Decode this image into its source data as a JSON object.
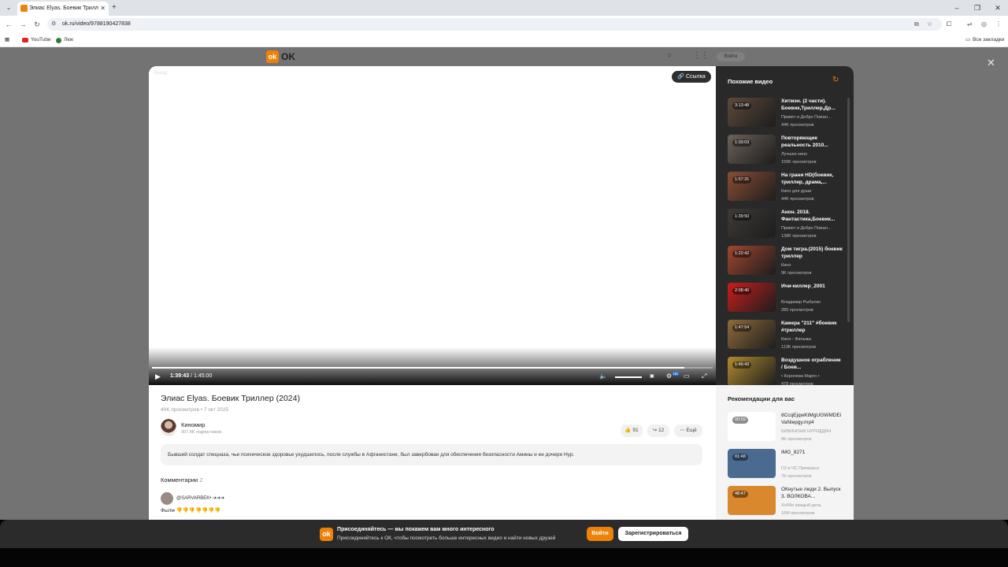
{
  "browser": {
    "tab_title": "Элиас Elyas. Боевик Триллер (2024)",
    "url": "ok.ru/video/9788190427838",
    "bookmarks": [
      "YouTube",
      "Люк"
    ],
    "all_bookmarks": "Все закладки"
  },
  "header": {
    "logo_text": "OK",
    "login_label": "Войти"
  },
  "player": {
    "back_label": "Назад",
    "link_label": "Ссылка",
    "current_time": "1:39:43",
    "total_time": "1:45:00",
    "progress": 0.95,
    "hd_badge": "HD"
  },
  "video": {
    "title": "Элиас  Elyas.  Боевик Триллер  (2024)",
    "meta": "40K просмотров • 7 окт 2025",
    "channel_name": "Киномир",
    "channel_subs": "907.8K подписчиков",
    "likes": "91",
    "shares": "12",
    "more_label": "Ещё",
    "description": "Бывший солдат спецназа, чье психическое здоровье ухудшилось, после службы в Афганистане, был завербован для обеспечения безопасности Амины и ее дочери Нур."
  },
  "comments": {
    "heading": "Комментарии",
    "count": "2",
    "first_user": "@SARVARBEK• ➔➔➔",
    "first_text": "Фылм 👎👎👎👎👎👎👎"
  },
  "related": {
    "heading": "Похожие видео",
    "items": [
      {
        "duration": "3:13:48",
        "title": "Хитмэн. (2 части). Боевик,Триллер,Др...",
        "channel": "Привет и Добро Пожал...",
        "views": "44K просмотров",
        "color": "#5d4a3a"
      },
      {
        "duration": "1:33:03",
        "title": "Повторяющие реальность 2010...",
        "channel": "Лучшее кино",
        "views": "150K просмотров",
        "color": "#6b6158"
      },
      {
        "duration": "1:57:31",
        "title": "На грани HD(боевик, триллер, драма,...",
        "channel": "Кино для души",
        "views": "44K просмотров",
        "color": "#8a4d34"
      },
      {
        "duration": "1:39:50",
        "title": "Анон. 2018. Фантастика,Боевик...",
        "channel": "Привет и Добро Пожал...",
        "views": "138K просмотров",
        "color": "#3e3a36"
      },
      {
        "duration": "1:22:42",
        "title": "Дом тигра.(2015) боевик триллер",
        "channel": "Кино",
        "views": "9K просмотров",
        "color": "#a0472f"
      },
      {
        "duration": "2:08:40",
        "title": "Ичи-киллер_2001",
        "channel": "Владимир Рыбалко",
        "views": "285 просмотров",
        "color": "#c81d1d"
      },
      {
        "duration": "1:47:54",
        "title": "Камера \"211\" #боевик #триллер",
        "channel": "Кино - Фильмы",
        "views": "113K просмотров",
        "color": "#8f6a3c"
      },
      {
        "duration": "1:46:43",
        "title": "Воздушное ограбление / Боев...",
        "channel": "• Королева Марго •",
        "views": "478 просмотров",
        "color": "#b08a2e"
      }
    ]
  },
  "recommendations": {
    "heading": "Рекомендации для вас",
    "items": [
      {
        "duration": "00:59",
        "title": "8CcqEjqwKtMgUGWMDEiVaNiepgy.mp4",
        "channel": "БИБИНОНИ НУРИДДИН",
        "views": "8K просмотров",
        "color": "#ffffff"
      },
      {
        "duration": "01:48",
        "title": "IMG_8271",
        "channel": "ГО и ЧС Приморья",
        "views": "7K просмотров",
        "color": "#4a6b8f"
      },
      {
        "duration": "48:47",
        "title": "ОКнутые люди 2. Выпуск 3. ВОЛКОВА...",
        "channel": "Хобби каждый день",
        "views": "16M просмотров",
        "color": "#d9882e"
      }
    ]
  },
  "join_banner": {
    "headline": "Присоединяйтесь — мы покажем вам много интересного",
    "subline": "Присоединяйтесь к ОК, чтобы посмотреть больше интересных видео и найти новых друзей",
    "login_label": "Войти",
    "register_label": "Зарегистрироваться"
  },
  "colors": {
    "accent": "#ee8208",
    "sidebar_dark": "#292929",
    "overlay": "#737373"
  }
}
